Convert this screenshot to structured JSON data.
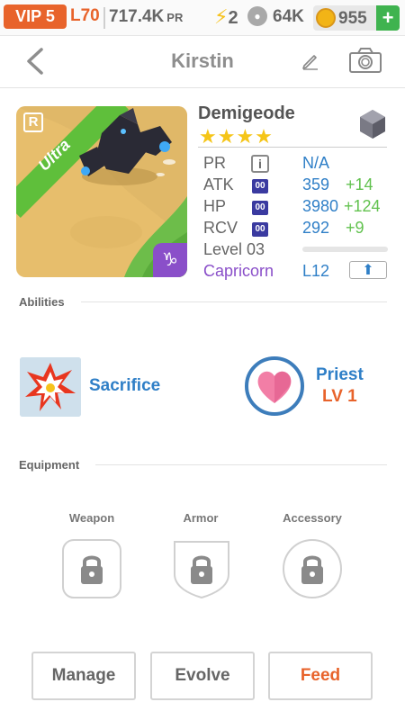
{
  "topbar": {
    "vip": "VIP 5",
    "level": "L70",
    "pr_value": "717.4K",
    "pr_label": "PR",
    "energy": "2",
    "paw_value": "64K",
    "coins": "955",
    "add_label": "+"
  },
  "header": {
    "title": "Kirstin"
  },
  "monster": {
    "rank_badge": "R",
    "rarity": "Ultra",
    "name": "Demigeode",
    "stars": "★★★★",
    "sign_symbol": "♑",
    "stats": {
      "pr_label": "PR",
      "pr_info": "i",
      "pr_value": "N/A",
      "atk_label": "ATK",
      "atk_badge": "00",
      "atk_value": "359",
      "atk_bonus": "+14",
      "hp_label": "HP",
      "hp_badge": "00",
      "hp_value": "3980",
      "hp_bonus": "+124",
      "rcv_label": "RCV",
      "rcv_badge": "00",
      "rcv_value": "292",
      "rcv_bonus": "+9",
      "level_label": "Level 03",
      "level_progress": 0,
      "sign_name": "Capricorn",
      "sign_level": "L12"
    }
  },
  "abilities": {
    "heading": "Abilities",
    "skill_name": "Sacrifice",
    "class_name": "Priest",
    "class_level": "LV 1"
  },
  "equipment": {
    "heading": "Equipment",
    "slots": [
      "Weapon",
      "Armor",
      "Accessory"
    ]
  },
  "actions": {
    "manage": "Manage",
    "evolve": "Evolve",
    "feed": "Feed"
  },
  "colors": {
    "accent_orange": "#e8632b",
    "stat_blue": "#2f7fc7",
    "bonus_green": "#62c24f",
    "zodiac_purple": "#8a4fc9"
  }
}
